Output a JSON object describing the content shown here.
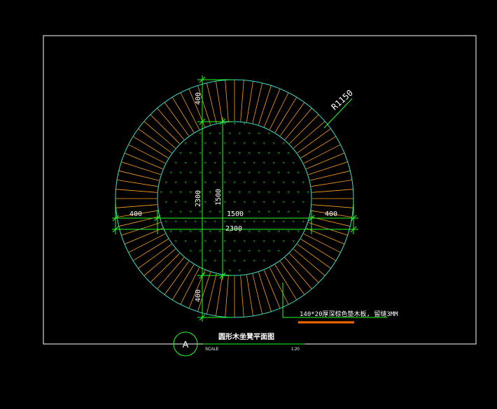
{
  "drawing": {
    "radius_label": "R1150",
    "outer_dim_vertical": "2300",
    "inner_dim_vertical": "1500",
    "inner_dim_horizontal": "1500",
    "outer_dim_horizontal": "2300",
    "ring_top": "400",
    "ring_bottom": "400",
    "ring_left": "400",
    "ring_right": "400",
    "material_note": "140*20厚深棕色垫木板, 留缝3MM",
    "outer_radius_mm": 1150,
    "inner_radius_mm": 750,
    "slat_count": 80
  },
  "title_block": {
    "marker": "A",
    "title": "圆形木坐凳平面图",
    "scale_label": "SCALE",
    "scale_value": "1:20"
  },
  "colors": {
    "background": "#000000",
    "frame": "#ffffff",
    "circle": "#3fe0c8",
    "slat": "#ff9f1a",
    "dimension": "#22ff22",
    "hatch": "#1fbf1f",
    "text": "#ffffff",
    "underline": "#ff6a00"
  }
}
